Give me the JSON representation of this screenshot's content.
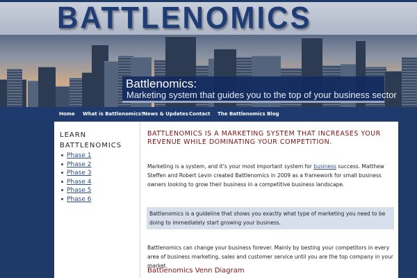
{
  "site": {
    "logo": "BATTLENOMICS",
    "banner_title": "Battlenomics:",
    "banner_subtitle": "Marketing system that guides you to the top of your business sector"
  },
  "nav": {
    "items": [
      {
        "label": "Home"
      },
      {
        "label": "What is Battlenomics?"
      },
      {
        "label": "News & Updates"
      },
      {
        "label": "Contact"
      },
      {
        "label": "The Battlenomics Blog"
      }
    ]
  },
  "sidebar": {
    "title": "LEARN BATTLENOMICS",
    "phases": [
      "Phase 1",
      "Phase 2",
      "Phase 3",
      "Phase 4",
      "Phase 5",
      "Phase 6"
    ]
  },
  "main": {
    "headline": "BATTLENOMICS IS A MARKETING SYSTEM THAT INCREASES YOUR REVENUE WHILE DOMINATING YOUR COMPETITION.",
    "para1_before": "Marketing is a system, and it’s your most important system for ",
    "para1_link": "business",
    "para1_after": " success. Matthew Steffen and Robert Levin created Battlenomics in 2009 as a framework for small business owners looking to grow their business in a competitive business landscape.",
    "callout": "Battlenomics is a guideline that shows you exactly what type of marketing you need to be doing to immediately start growing your business.",
    "para2": "Battlenomics can change your business forever. Mainly by besting your competitors in every area of business marketing, sales and customer service until you are the top company in your market.",
    "section_heading": "Battlenomics Venn Diagram"
  },
  "colors": {
    "brand_navy": "#1f3a6e",
    "headline_red": "#7a1010",
    "link_blue": "#2b4a8a",
    "callout_bg": "#d7dfec"
  }
}
